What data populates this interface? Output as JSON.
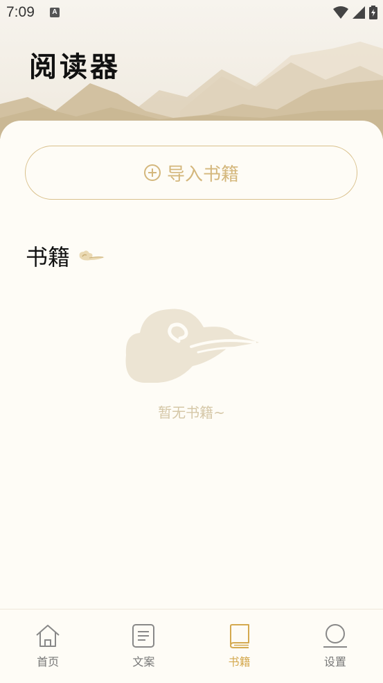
{
  "status": {
    "time": "7:09",
    "notification_badge": "A"
  },
  "header": {
    "title": "阅读器"
  },
  "import_button": {
    "label": "导入书籍",
    "icon": "plus-circle-icon"
  },
  "section": {
    "title": "书籍"
  },
  "empty_state": {
    "text": "暂无书籍~"
  },
  "nav": {
    "items": [
      {
        "label": "首页",
        "icon": "home-icon",
        "active": false
      },
      {
        "label": "文案",
        "icon": "document-icon",
        "active": false
      },
      {
        "label": "书籍",
        "icon": "book-icon",
        "active": true
      },
      {
        "label": "设置",
        "icon": "settings-circle-icon",
        "active": false
      }
    ]
  },
  "colors": {
    "accent": "#d4a94f",
    "button_border": "#d9c08b",
    "background": "#fefcf6"
  }
}
